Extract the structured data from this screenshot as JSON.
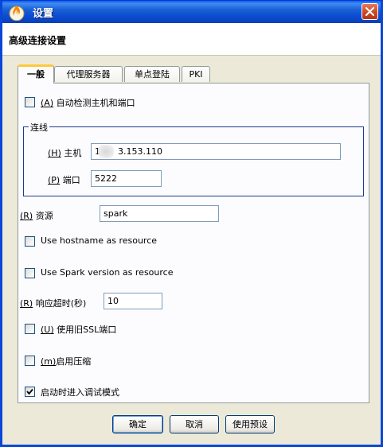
{
  "window": {
    "title": "设置",
    "close_glyph": "✕"
  },
  "header": {
    "title": "高级连接设置"
  },
  "tabs": [
    {
      "label": "一般",
      "active": true
    },
    {
      "label": "代理服务器",
      "active": false
    },
    {
      "label": "单点登陆",
      "active": false
    },
    {
      "label": "PKI",
      "active": false
    }
  ],
  "general": {
    "auto_detect": {
      "mnemonic": "(A)",
      "label": "自动检测主机和端口",
      "checked": false
    },
    "connection": {
      "legend": "连线",
      "host": {
        "mnemonic": "(H)",
        "label": "主机",
        "value_prefix": "1",
        "value_suffix": "3.153.110"
      },
      "port": {
        "mnemonic": "(P)",
        "label": "端口",
        "value": "5222"
      }
    },
    "resource": {
      "mnemonic": "(R)",
      "label": "资源",
      "value": "spark"
    },
    "use_hostname": {
      "label": "Use hostname as resource",
      "checked": false
    },
    "use_spark_version": {
      "label": "Use Spark version as resource",
      "checked": false
    },
    "timeout": {
      "mnemonic": "(R)",
      "label": "响应超时(秒)",
      "value": "10"
    },
    "old_ssl": {
      "mnemonic": "(U)",
      "label": "使用旧SSL端口",
      "checked": false
    },
    "compression": {
      "mnemonic": "(m)",
      "label": "启用压缩",
      "checked": false
    },
    "debug_mode": {
      "label": "启动时进入调试模式",
      "checked": true
    }
  },
  "buttons": {
    "ok": "确定",
    "cancel": "取消",
    "defaults": "使用预设"
  },
  "colors": {
    "titlebar": "#0b4bd0",
    "panel": "#ece9d8",
    "tab_accent": "#ffc83c",
    "checkbox_border": "#1c5180"
  },
  "icons": {
    "app": "spark-flame-icon",
    "close": "close-icon",
    "check": "checkmark-icon"
  }
}
